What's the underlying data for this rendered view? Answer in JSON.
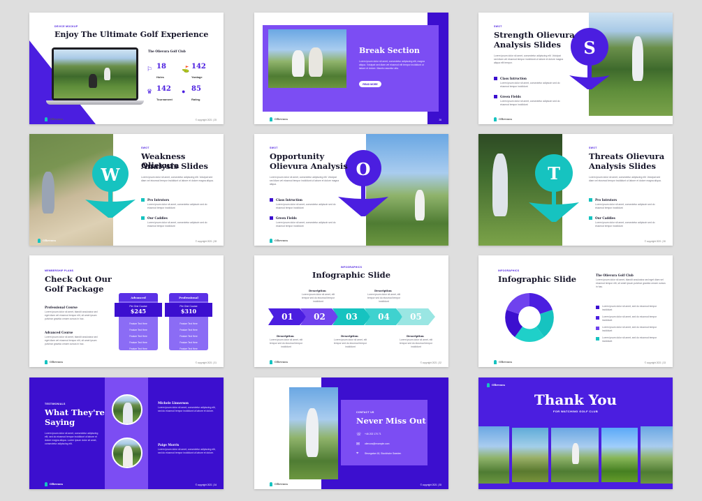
{
  "slides": {
    "s1": {
      "kicker": "DEVICE MOCKUP",
      "title": "Enjoy The Ultimate Golf Experience",
      "club": "The Olievura Golf Club",
      "stats": [
        {
          "value": "18",
          "label": "Holes"
        },
        {
          "value": "142",
          "label": "Yardage"
        },
        {
          "value": "142",
          "label": "Tournament"
        },
        {
          "value": "85",
          "label": "Rating"
        }
      ],
      "footer": "Olievura",
      "copyright": "© copyright 2021",
      "page": "25"
    },
    "s2": {
      "title": "Break Section",
      "body": "Lorem ipsum dolor sit amet, consectetur adipiscing elit, magna aliqua. Volutpat sed diam vel eiusmod elit tempor incididunt ut labore et dolore. Mauris nascetur alia.",
      "button": "READ MORE",
      "footer": "Olievura",
      "page": "26"
    },
    "s3": {
      "kicker": "SWOT",
      "title1": "Strength Olievura",
      "title2": "Analysis Slides",
      "letter": "S",
      "body": "Lorem ipsum dolor sit amet, consectetur adipiscing elit. Volutpat sed diam vel eiusmod tempor incididunt ut labore et dolore magna aliqua elit tempor.",
      "items": [
        {
          "title": "Class Intruction",
          "text": "Lorem ipsum dolor sit amet, consectetur adipiscin sed do eiusmod tempor incididunt"
        },
        {
          "title": "Green Fields",
          "text": "Lorem ipsum dolor sit amet, consectetur adipiscin sed do eiusmod tempor incididunt"
        }
      ],
      "footer": "Olievura"
    },
    "s4": {
      "kicker": "SWOT",
      "title1": "Weakness Olievura",
      "title2": "Analysis Slides",
      "letter": "W",
      "body": "Lorem ipsum dolor sit amet, consectetur adipiscing elit. Volutpat sed diam vel eiusmod tempor incididunt ut labore et dolore magna aliqua.",
      "items": [
        {
          "title": "Pro Intrutors",
          "text": "Lorem ipsum dolor sit amet, consectetur adipiscin sed do eiusmod tempor incididunt"
        },
        {
          "title": "Our Caddies",
          "text": "Lorem ipsum dolor sit amet, consectetur adipiscin sed do eiusmod tempor incididunt"
        }
      ],
      "footer": "Olievura",
      "copyright": "© copyright 2021",
      "page": "28"
    },
    "s5": {
      "kicker": "SWOT",
      "title1": "Opportunity",
      "title2": "Olievura Analysis",
      "letter": "O",
      "body": "Lorem ipsum dolor sit amet, consectetur adipiscing elit. Volutpat sed diam vel eiusmod tempor incididunt ut labore et dolore magna aliqua.",
      "items": [
        {
          "title": "Class Intruction",
          "text": "Lorem ipsum dolor sit amet, consectetur adipiscin sed do eiusmod tempor incididunt"
        },
        {
          "title": "Green Fields",
          "text": "Lorem ipsum dolor sit amet, consectetur adipiscin sed do eiusmod tempor incididunt"
        }
      ],
      "footer": "Olievura"
    },
    "s6": {
      "kicker": "SWOT",
      "title1": "Threats Olievura",
      "title2": "Analysis Slides",
      "letter": "T",
      "body": "Lorem ipsum dolor sit amet, consectetur adipiscing elit. Volutpat sed diam vel eiusmod tempor incididunt ut labore et dolore magna aliqua.",
      "items": [
        {
          "title": "Pro Intrutors",
          "text": "Lorem ipsum dolor sit amet, consectetur adipiscin sed do eiusmod tempor incididunt"
        },
        {
          "title": "Our Caddies",
          "text": "Lorem ipsum dolor sit amet, consectetur adipiscin sed do eiusmod tempor incididunt"
        }
      ],
      "copyright": "© copyright 2021",
      "page": "30"
    },
    "s7": {
      "kicker": "MEMBERSHIP PLANS",
      "title1": "Check Out Our",
      "title2": "Golf Package",
      "items": [
        {
          "title": "Professional Course",
          "text": "Lorem ipsum dolor sit amet, blandit arculusina sed eget diam vel eiusmod tempor elit, sit amet ipsum pulvinar gravida ornare cursus in hac."
        },
        {
          "title": "Advanced Course",
          "text": "Lorem ipsum dolor sit amet, blandit arculusina sed eget diam vel eiusmod tempor elit, sit amet ipsum pulvinar gravida ornare cursus in hac."
        }
      ],
      "plans": [
        {
          "name": "Advanced",
          "per": "Per One Course",
          "price": "$245",
          "features": [
            "Feature Text Here",
            "Feature Text Here",
            "Feature Text Here",
            "Feature Text Here",
            "Feature Text Here"
          ]
        },
        {
          "name": "Professional",
          "per": "Per One Course",
          "price": "$310",
          "features": [
            "Feature Text Here",
            "Feature Text Here",
            "Feature Text Here",
            "Feature Text Here",
            "Feature Text Here"
          ]
        }
      ],
      "footer": "Olievura",
      "copyright": "© copyright 2021",
      "page": "31"
    },
    "s8": {
      "kicker": "INFOGRAPHICS",
      "title": "Infographic Slide",
      "steps": [
        "01",
        "02",
        "03",
        "04",
        "05"
      ],
      "label": "Description",
      "text": "Lorem ipsum dolor sit amet, elit tempor sed do eiusmod tempor incididunt",
      "footer": "Olievura",
      "copyright": "© copyright 2021",
      "page": "32"
    },
    "s9": {
      "kicker": "INFOGRAPHICS",
      "title": "Infographic Slide",
      "club": "The Olievura Golf Club",
      "body": "Lorem ipsum dolor sit amet, blandit arculusina sed eget diam vel eiusmod tempor elit, sit amet ipsum pulvinar gravida ornare cursus in hac.",
      "items": [
        "Lorem ipsum dolor sit amet, sed do eiusmod tempor incididunt",
        "Lorem ipsum dolor sit amet, sed do eiusmod tempor incididunt",
        "Lorem ipsum dolor sit amet, sed do eiusmod tempor incididunt",
        "Lorem ipsum dolor sit amet, sed do eiusmod tempor incididunt"
      ],
      "footer": "Olievura",
      "copyright": "© copyright 2021",
      "page": "33"
    },
    "s10": {
      "kicker": "TESTIMONIALS",
      "title1": "What They're",
      "title2": "Saying",
      "body": "Lorem ipsum dolor sit amet, consectetur adipiscing elit, sed do eiusmod tempor incididunt ut labore et dolore magna aliqua. Lorem ipsum dolor sit amet, consectetur adipiscing elit.",
      "people": [
        {
          "name": "Michele Linnerson",
          "text": "Lorem ipsum dolor sit amet, consectetur adipiscing elit, sed do eiusmod tempor incididunt ut labore et dolore."
        },
        {
          "name": "Paige Morris",
          "text": "Lorem ipsum dolor sit amet, consectetur adipiscing elit, sed do eiusmod tempor incididunt ut labore et dolore."
        }
      ],
      "footer": "Olievura",
      "copyright": "© copyright 2021",
      "page": "34"
    },
    "s11": {
      "kicker": "CONTACT US",
      "title": "Never Miss Out",
      "contacts": [
        "+46 202 170 71",
        "olievura@example.com",
        "Strungatan 18, Stockholm Sweden"
      ],
      "footer": "Olievura",
      "copyright": "© copyright 2021",
      "page": "35"
    },
    "s12": {
      "footer": "Olievura",
      "title": "Thank You",
      "subtitle": "FOR WATCHING GOLF CLUB"
    }
  },
  "colors": {
    "primary": "#4b1ee0",
    "deep": "#3c0fcf",
    "teal": "#16c3c0",
    "light": "#8b6cf5"
  }
}
